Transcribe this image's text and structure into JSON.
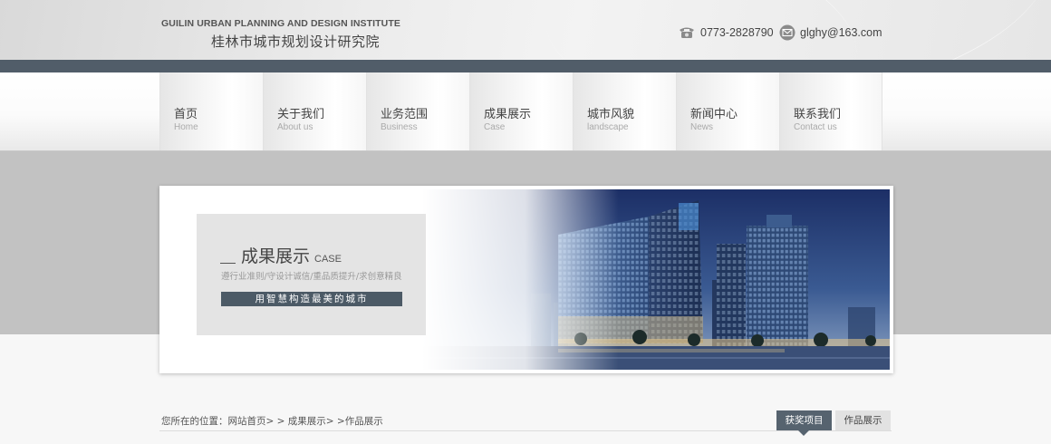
{
  "header": {
    "logo_en": "GUILIN URBAN PLANNING AND DESIGN INSTITUTE",
    "logo_cn": "桂林市城市规划设计研究院",
    "phone": "0773-2828790",
    "email": "glghy@163.com"
  },
  "nav": {
    "items": [
      {
        "cn": "首页",
        "en": "Home"
      },
      {
        "cn": "关于我们",
        "en": "About us"
      },
      {
        "cn": "业务范围",
        "en": "Business"
      },
      {
        "cn": "成果展示",
        "en": "Case"
      },
      {
        "cn": "城市风貌",
        "en": "landscape"
      },
      {
        "cn": "新闻中心",
        "en": "News"
      },
      {
        "cn": "联系我们",
        "en": "Contact us"
      }
    ]
  },
  "banner": {
    "title_cn": "成果展示",
    "title_en": "CASE",
    "subtitle": "遵行业准则/守设计诚信/重品质提升/求创意精良",
    "slogan": "用智慧构造最美的城市"
  },
  "breadcrumb": "您所在的位置：网站首页> > 成果展示> >作品展示",
  "tabs": {
    "active": "获奖项目",
    "other": "作品展示"
  },
  "colors": {
    "accent_dark": "#515d69",
    "banner_gray": "#c2c2c2"
  }
}
